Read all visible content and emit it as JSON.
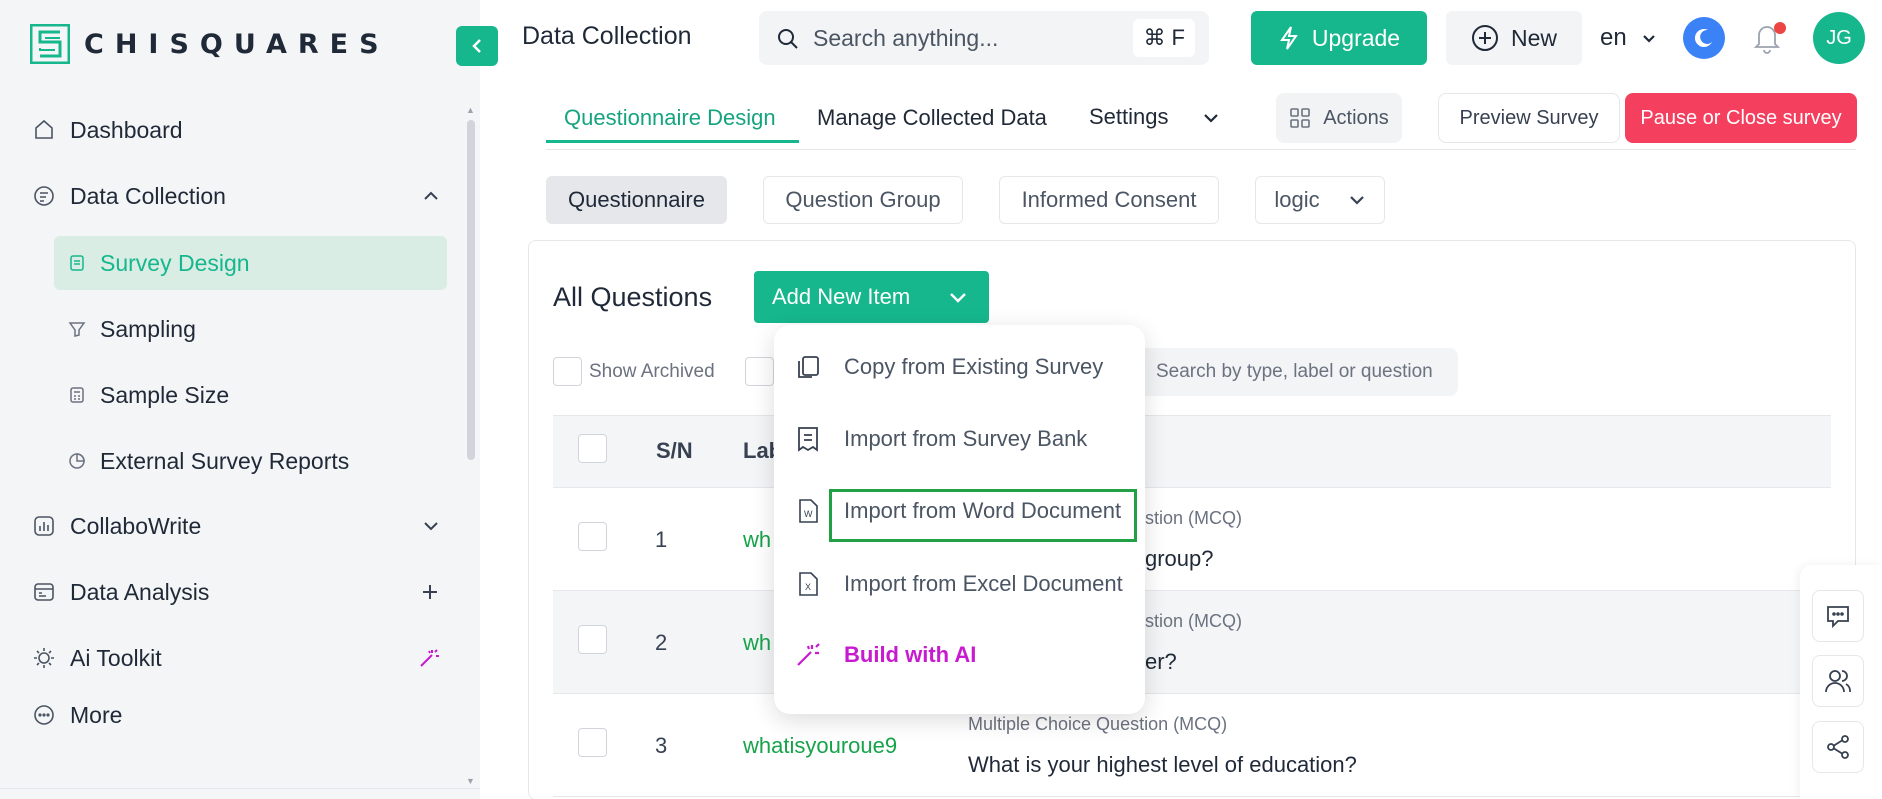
{
  "app": {
    "logo_text": "CHISQUARES",
    "brand_color": "#16b78d"
  },
  "sidebar": {
    "items": [
      {
        "label": "Dashboard",
        "icon": "home-icon"
      },
      {
        "label": "Data Collection",
        "icon": "data-collection-icon",
        "expanded": true
      },
      {
        "label": "CollaboWrite",
        "icon": "chart-icon"
      },
      {
        "label": "Data Analysis",
        "icon": "analysis-icon"
      },
      {
        "label": "Ai Toolkit",
        "icon": "sun-icon"
      },
      {
        "label": "More",
        "icon": "more-icon"
      }
    ],
    "sub_items": [
      {
        "label": "Survey Design",
        "active": true
      },
      {
        "label": "Sampling"
      },
      {
        "label": "Sample Size"
      },
      {
        "label": "External Survey Reports"
      }
    ]
  },
  "header": {
    "title": "Data Collection",
    "search_placeholder": "Search anything...",
    "shortcut": "⌘ F",
    "upgrade_label": "Upgrade",
    "new_label": "New",
    "language": "en",
    "avatar_initials": "JG"
  },
  "tabs": {
    "items": [
      "Questionnaire Design",
      "Manage Collected Data",
      "Settings"
    ],
    "active": "Questionnaire Design",
    "actions_label": "Actions",
    "preview_label": "Preview Survey",
    "pause_label": "Pause or Close survey"
  },
  "subtabs": {
    "items": [
      "Questionnaire",
      "Question Group",
      "Informed Consent"
    ],
    "logic_label": "logic"
  },
  "questions": {
    "title": "All Questions",
    "add_new_label": "Add New Item",
    "show_archived_label": "Show Archived",
    "search_placeholder": "Search by type, label or question",
    "columns": {
      "sn": "S/N",
      "label": "Lab"
    },
    "rows": [
      {
        "sn": "1",
        "label": "wh",
        "type_end": "stion (MCQ)",
        "question_end": "group?"
      },
      {
        "sn": "2",
        "label": "wh",
        "type_end": "stion (MCQ)",
        "question_end": "er?"
      },
      {
        "sn": "3",
        "label": "whatisyouroue9",
        "type": "Multiple Choice Question (MCQ)",
        "question": "What is your highest level of education?"
      }
    ]
  },
  "menu": {
    "items": [
      {
        "label": "Copy from Existing Survey",
        "icon": "copy-icon"
      },
      {
        "label": "Import from Survey Bank",
        "icon": "survey-bank-icon"
      },
      {
        "label": "Import from Word Document",
        "icon": "word-document-icon",
        "highlighted": true
      },
      {
        "label": "Import from Excel Document",
        "icon": "excel-document-icon"
      },
      {
        "label": "Build with AI",
        "icon": "magic-wand-icon"
      }
    ]
  }
}
